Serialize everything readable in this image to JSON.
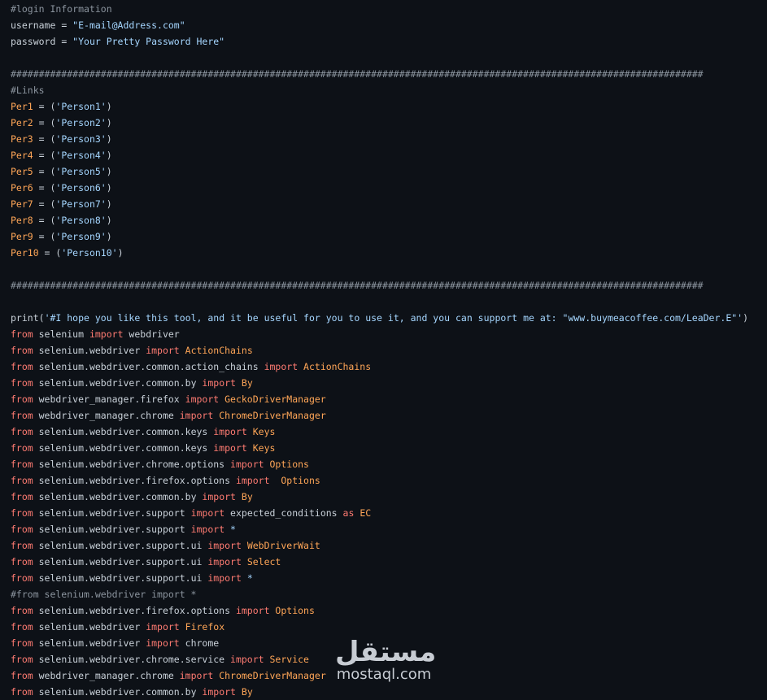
{
  "code_lines": [
    [
      {
        "t": "#login Information",
        "c": "cm"
      }
    ],
    [
      {
        "t": "username",
        "c": "pl"
      },
      {
        "t": " = ",
        "c": "pl"
      },
      {
        "t": "\"E-mail@Address.com\"",
        "c": "str"
      }
    ],
    [
      {
        "t": "password",
        "c": "pl"
      },
      {
        "t": " = ",
        "c": "pl"
      },
      {
        "t": "\"Your Pretty Password Here\"",
        "c": "str"
      }
    ],
    [],
    [
      {
        "t": "###########################################################################################################################",
        "c": "cm"
      }
    ],
    [
      {
        "t": "#Links",
        "c": "cm"
      }
    ],
    [
      {
        "t": "Per1",
        "c": "var"
      },
      {
        "t": " = (",
        "c": "pl"
      },
      {
        "t": "'Person1'",
        "c": "str"
      },
      {
        "t": ")",
        "c": "pl"
      }
    ],
    [
      {
        "t": "Per2",
        "c": "var"
      },
      {
        "t": " = (",
        "c": "pl"
      },
      {
        "t": "'Person2'",
        "c": "str"
      },
      {
        "t": ")",
        "c": "pl"
      }
    ],
    [
      {
        "t": "Per3",
        "c": "var"
      },
      {
        "t": " = (",
        "c": "pl"
      },
      {
        "t": "'Person3'",
        "c": "str"
      },
      {
        "t": ")",
        "c": "pl"
      }
    ],
    [
      {
        "t": "Per4",
        "c": "var"
      },
      {
        "t": " = (",
        "c": "pl"
      },
      {
        "t": "'Person4'",
        "c": "str"
      },
      {
        "t": ")",
        "c": "pl"
      }
    ],
    [
      {
        "t": "Per5",
        "c": "var"
      },
      {
        "t": " = (",
        "c": "pl"
      },
      {
        "t": "'Person5'",
        "c": "str"
      },
      {
        "t": ")",
        "c": "pl"
      }
    ],
    [
      {
        "t": "Per6",
        "c": "var"
      },
      {
        "t": " = (",
        "c": "pl"
      },
      {
        "t": "'Person6'",
        "c": "str"
      },
      {
        "t": ")",
        "c": "pl"
      }
    ],
    [
      {
        "t": "Per7",
        "c": "var"
      },
      {
        "t": " = (",
        "c": "pl"
      },
      {
        "t": "'Person7'",
        "c": "str"
      },
      {
        "t": ")",
        "c": "pl"
      }
    ],
    [
      {
        "t": "Per8",
        "c": "var"
      },
      {
        "t": " = (",
        "c": "pl"
      },
      {
        "t": "'Person8'",
        "c": "str"
      },
      {
        "t": ")",
        "c": "pl"
      }
    ],
    [
      {
        "t": "Per9",
        "c": "var"
      },
      {
        "t": " = (",
        "c": "pl"
      },
      {
        "t": "'Person9'",
        "c": "str"
      },
      {
        "t": ")",
        "c": "pl"
      }
    ],
    [
      {
        "t": "Per10",
        "c": "var"
      },
      {
        "t": " = (",
        "c": "pl"
      },
      {
        "t": "'Person10'",
        "c": "str"
      },
      {
        "t": ")",
        "c": "pl"
      }
    ],
    [],
    [
      {
        "t": "###########################################################################################################################",
        "c": "cm"
      }
    ],
    [],
    [
      {
        "t": "print",
        "c": "pl"
      },
      {
        "t": "(",
        "c": "pl"
      },
      {
        "t": "'#I hope you like this tool, and it be useful for you to use it, and you can support me at: \"www.buymeacoffee.com/LeaDer.E\"'",
        "c": "str"
      },
      {
        "t": ")",
        "c": "pl"
      }
    ],
    [
      {
        "t": "from",
        "c": "kw"
      },
      {
        "t": " selenium ",
        "c": "pl"
      },
      {
        "t": "import",
        "c": "kw"
      },
      {
        "t": " webdriver",
        "c": "pl"
      }
    ],
    [
      {
        "t": "from",
        "c": "kw"
      },
      {
        "t": " selenium.webdriver ",
        "c": "pl"
      },
      {
        "t": "import",
        "c": "kw"
      },
      {
        "t": " ActionChains",
        "c": "var"
      }
    ],
    [
      {
        "t": "from",
        "c": "kw"
      },
      {
        "t": " selenium.webdriver.common.action_chains ",
        "c": "pl"
      },
      {
        "t": "import",
        "c": "kw"
      },
      {
        "t": " ActionChains",
        "c": "var"
      }
    ],
    [
      {
        "t": "from",
        "c": "kw"
      },
      {
        "t": " selenium.webdriver.common.by ",
        "c": "pl"
      },
      {
        "t": "import",
        "c": "kw"
      },
      {
        "t": " By",
        "c": "var"
      }
    ],
    [
      {
        "t": "from",
        "c": "kw"
      },
      {
        "t": " webdriver_manager.firefox ",
        "c": "pl"
      },
      {
        "t": "import",
        "c": "kw"
      },
      {
        "t": " GeckoDriverManager",
        "c": "var"
      }
    ],
    [
      {
        "t": "from",
        "c": "kw"
      },
      {
        "t": " webdriver_manager.chrome ",
        "c": "pl"
      },
      {
        "t": "import",
        "c": "kw"
      },
      {
        "t": " ChromeDriverManager",
        "c": "var"
      }
    ],
    [
      {
        "t": "from",
        "c": "kw"
      },
      {
        "t": " selenium.webdriver.common.keys ",
        "c": "pl"
      },
      {
        "t": "import",
        "c": "kw"
      },
      {
        "t": " Keys",
        "c": "var"
      }
    ],
    [
      {
        "t": "from",
        "c": "kw"
      },
      {
        "t": " selenium.webdriver.common.keys ",
        "c": "pl"
      },
      {
        "t": "import",
        "c": "kw"
      },
      {
        "t": " Keys",
        "c": "var"
      }
    ],
    [
      {
        "t": "from",
        "c": "kw"
      },
      {
        "t": " selenium.webdriver.chrome.options ",
        "c": "pl"
      },
      {
        "t": "import",
        "c": "kw"
      },
      {
        "t": " Options",
        "c": "var"
      }
    ],
    [
      {
        "t": "from",
        "c": "kw"
      },
      {
        "t": " selenium.webdriver.firefox.options ",
        "c": "pl"
      },
      {
        "t": "import",
        "c": "kw"
      },
      {
        "t": "  Options",
        "c": "var"
      }
    ],
    [
      {
        "t": "from",
        "c": "kw"
      },
      {
        "t": " selenium.webdriver.common.by ",
        "c": "pl"
      },
      {
        "t": "import",
        "c": "kw"
      },
      {
        "t": " By",
        "c": "var"
      }
    ],
    [
      {
        "t": "from",
        "c": "kw"
      },
      {
        "t": " selenium.webdriver.support ",
        "c": "pl"
      },
      {
        "t": "import",
        "c": "kw"
      },
      {
        "t": " expected_conditions ",
        "c": "pl"
      },
      {
        "t": "as",
        "c": "kw"
      },
      {
        "t": " EC",
        "c": "var"
      }
    ],
    [
      {
        "t": "from",
        "c": "kw"
      },
      {
        "t": " selenium.webdriver.support ",
        "c": "pl"
      },
      {
        "t": "import",
        "c": "kw"
      },
      {
        "t": " *",
        "c": "str"
      }
    ],
    [
      {
        "t": "from",
        "c": "kw"
      },
      {
        "t": " selenium.webdriver.support.ui ",
        "c": "pl"
      },
      {
        "t": "import",
        "c": "kw"
      },
      {
        "t": " WebDriverWait",
        "c": "var"
      }
    ],
    [
      {
        "t": "from",
        "c": "kw"
      },
      {
        "t": " selenium.webdriver.support.ui ",
        "c": "pl"
      },
      {
        "t": "import",
        "c": "kw"
      },
      {
        "t": " Select",
        "c": "var"
      }
    ],
    [
      {
        "t": "from",
        "c": "kw"
      },
      {
        "t": " selenium.webdriver.support.ui ",
        "c": "pl"
      },
      {
        "t": "import",
        "c": "kw"
      },
      {
        "t": " *",
        "c": "str"
      }
    ],
    [
      {
        "t": "#from selenium.webdriver import *",
        "c": "cm"
      }
    ],
    [
      {
        "t": "from",
        "c": "kw"
      },
      {
        "t": " selenium.webdriver.firefox.options ",
        "c": "pl"
      },
      {
        "t": "import",
        "c": "kw"
      },
      {
        "t": " Options",
        "c": "var"
      }
    ],
    [
      {
        "t": "from",
        "c": "kw"
      },
      {
        "t": " selenium.webdriver ",
        "c": "pl"
      },
      {
        "t": "import",
        "c": "kw"
      },
      {
        "t": " Firefox",
        "c": "var"
      }
    ],
    [
      {
        "t": "from",
        "c": "kw"
      },
      {
        "t": " selenium.webdriver ",
        "c": "pl"
      },
      {
        "t": "import",
        "c": "kw"
      },
      {
        "t": " chrome",
        "c": "pl"
      }
    ],
    [
      {
        "t": "from",
        "c": "kw"
      },
      {
        "t": " selenium.webdriver.chrome.service ",
        "c": "pl"
      },
      {
        "t": "import",
        "c": "kw"
      },
      {
        "t": " Service",
        "c": "var"
      }
    ],
    [
      {
        "t": "from",
        "c": "kw"
      },
      {
        "t": " webdriver_manager.chrome ",
        "c": "pl"
      },
      {
        "t": "import",
        "c": "kw"
      },
      {
        "t": " ChromeDriverManager",
        "c": "var"
      }
    ],
    [
      {
        "t": "from",
        "c": "kw"
      },
      {
        "t": " selenium.webdriver.common.by ",
        "c": "pl"
      },
      {
        "t": "import",
        "c": "kw"
      },
      {
        "t": " By",
        "c": "var"
      }
    ]
  ],
  "watermark": {
    "arabic": "مستقل",
    "latin": "mostaql.com"
  },
  "colors": {
    "background": "#0d1117",
    "comment": "#8b949e",
    "keyword": "#ff7b72",
    "string": "#a5d6ff",
    "variable": "#ffa657",
    "plain": "#c9d1d9"
  }
}
